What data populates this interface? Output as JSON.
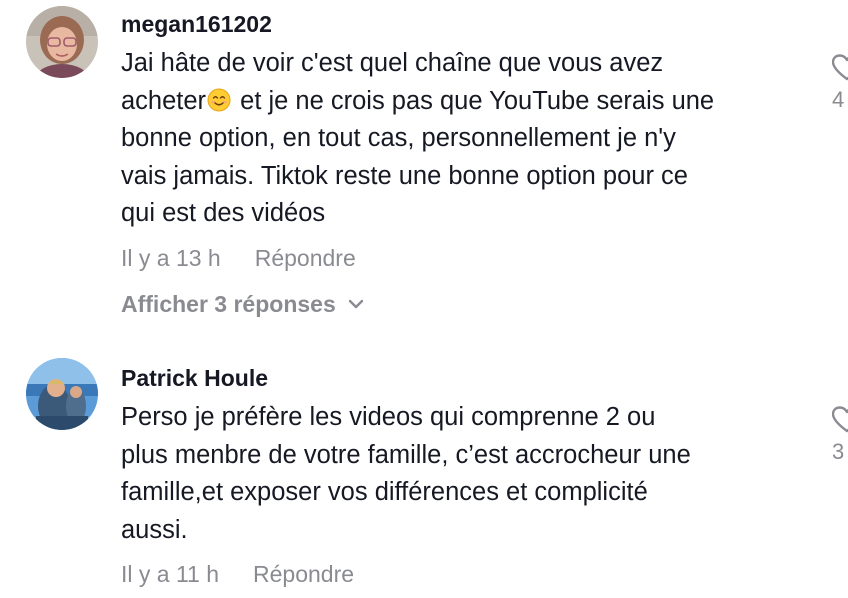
{
  "comments": [
    {
      "username": "megan161202",
      "text_part1": "Jai hâte de voir c'est quel chaîne que vous avez\nacheter",
      "emoji": "smiling-face-emoji",
      "text_part2": " et je ne crois pas que YouTube serais une\nbonne option, en tout cas, personnellement je n'y\nvais jamais. Tiktok reste une bonne option pour ce\nqui est des vidéos",
      "time": "Il y a 13 h",
      "reply_label": "Répondre",
      "show_replies_label": "Afficher 3 réponses",
      "like_count": "4"
    },
    {
      "username": "Patrick Houle",
      "text": "Perso je préfère les videos qui comprenne 2 ou\nplus menbre de votre famille, c’est accrocheur une\nfamille,et exposer vos différences et complicité\naussi.",
      "time": "Il y a 11 h",
      "reply_label": "Répondre",
      "like_count": "3"
    }
  ],
  "colors": {
    "text": "#161823",
    "secondary": "#8a8b91",
    "background": "#ffffff"
  }
}
